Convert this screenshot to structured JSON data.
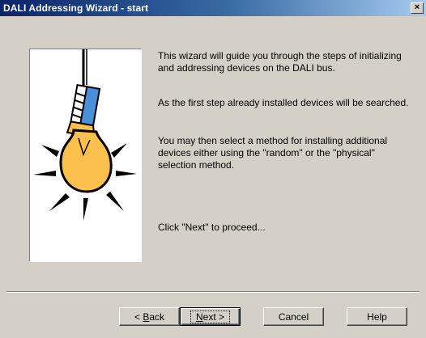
{
  "window": {
    "title": "DALI Addressing Wizard - start",
    "close_glyph": "×"
  },
  "illustration": {
    "icon": "light-bulb-icon",
    "colors": {
      "bulb": "#fcc04c",
      "socket": "#4a90d9",
      "outline": "#000000"
    }
  },
  "content": {
    "para1": "This wizard will guide you through the steps of initializing and addressing devices on the DALI bus.",
    "para2": "As the first step already installed devices will be searched.",
    "para3": "You may then select a method for installing additional devices either using the \"random\" or the \"physical\" selection method.",
    "para4": "Click \"Next\" to proceed..."
  },
  "buttons": {
    "back_prefix": "< ",
    "back_mnemonic": "B",
    "back_rest": "ack",
    "next_mnemonic": "N",
    "next_rest": "ext >",
    "cancel": "Cancel",
    "help": "Help"
  }
}
